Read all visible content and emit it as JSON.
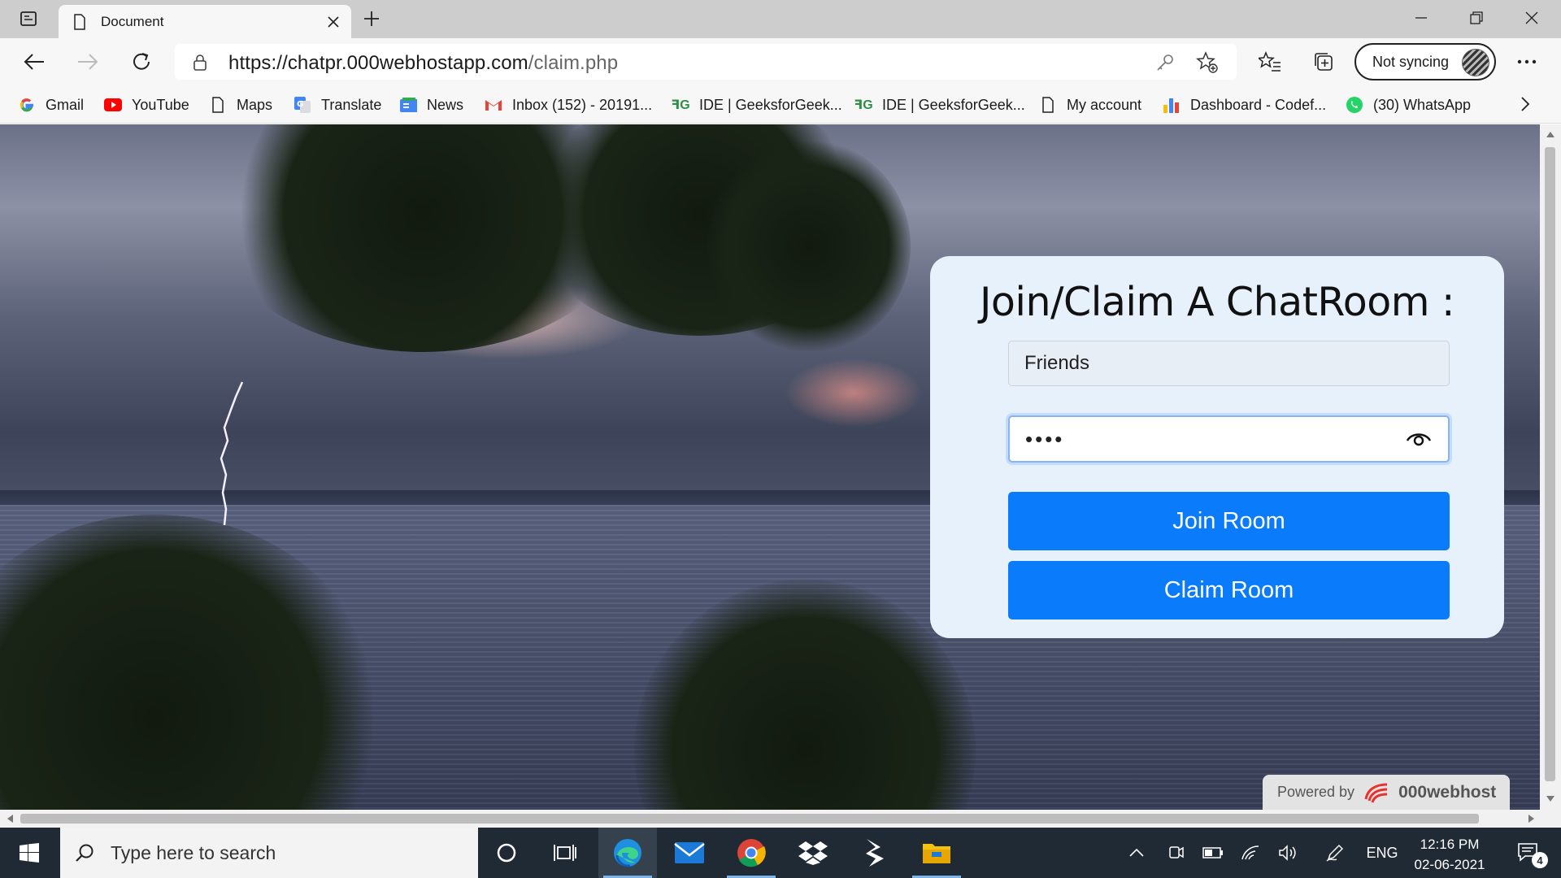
{
  "browser": {
    "tab_title": "Document",
    "url_host": "https://chatpr.000webhostapp.com",
    "url_path": "/claim.php",
    "sync_label": "Not syncing"
  },
  "bookmarks": [
    {
      "label": "Gmail",
      "icon": "google-icon"
    },
    {
      "label": "YouTube",
      "icon": "youtube-icon"
    },
    {
      "label": "Maps",
      "icon": "page-icon"
    },
    {
      "label": "Translate",
      "icon": "translate-icon"
    },
    {
      "label": "News",
      "icon": "news-icon"
    },
    {
      "label": "Inbox (152) - 20191...",
      "icon": "gmail-icon"
    },
    {
      "label": "IDE | GeeksforGeek...",
      "icon": "geeksforgeeks-icon"
    },
    {
      "label": "IDE | GeeksforGeek...",
      "icon": "geeksforgeeks-icon"
    },
    {
      "label": "My account",
      "icon": "page-icon"
    },
    {
      "label": "Dashboard - Codef...",
      "icon": "chart-icon"
    },
    {
      "label": "(30) WhatsApp",
      "icon": "whatsapp-icon"
    }
  ],
  "form": {
    "heading": "Join/Claim A ChatRoom :",
    "room_name_value": "Friends",
    "password_value": "••••",
    "join_button": "Join Room",
    "claim_button": "Claim Room"
  },
  "footer_badge": {
    "prefix": "Powered by",
    "brand": "000webhost"
  },
  "taskbar": {
    "search_placeholder": "Type here to search",
    "language": "ENG",
    "time": "12:16 PM",
    "date": "02-06-2021",
    "notification_count": "4"
  },
  "colors": {
    "primary_button": "#0a7bfb",
    "card_background": "#e7f1fb",
    "taskbar": "#202a34"
  }
}
